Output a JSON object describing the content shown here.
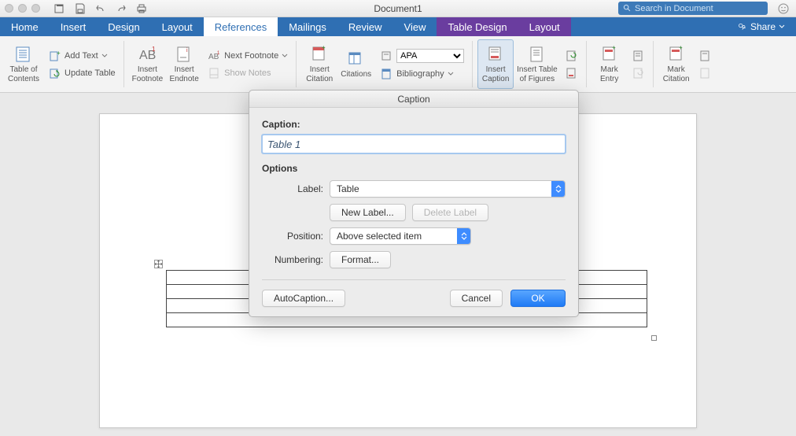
{
  "titlebar": {
    "document_title": "Document1",
    "search_placeholder": "Search in Document"
  },
  "tabs": {
    "items": [
      "Home",
      "Insert",
      "Design",
      "Layout",
      "References",
      "Mailings",
      "Review",
      "View",
      "Table Design",
      "Layout"
    ],
    "selected_index": 4,
    "context_start_index": 8,
    "share_label": "Share"
  },
  "ribbon": {
    "toc": {
      "label_line1": "Table of",
      "label_line2": "Contents",
      "add_text": "Add Text",
      "update_table": "Update Table"
    },
    "footnotes": {
      "insert_footnote": "Insert\nFootnote",
      "insert_endnote": "Insert\nEndnote",
      "next_footnote": "Next Footnote",
      "show_notes": "Show Notes"
    },
    "citations": {
      "insert_citation": "Insert\nCitation",
      "citations": "Citations",
      "style_label": "APA",
      "bibliography": "Bibliography"
    },
    "captions": {
      "insert_caption": "Insert\nCaption",
      "insert_tof": "Insert Table\nof Figures"
    },
    "index": {
      "mark_entry": "Mark\nEntry"
    },
    "authorities": {
      "mark_citation": "Mark\nCitation"
    }
  },
  "dialog": {
    "title": "Caption",
    "heading_caption": "Caption:",
    "caption_value": "Table 1",
    "heading_options": "Options",
    "label_label": "Label:",
    "label_value": "Table",
    "new_label_btn": "New Label...",
    "delete_label_btn": "Delete Label",
    "position_label": "Position:",
    "position_value": "Above selected item",
    "numbering_label": "Numbering:",
    "format_btn": "Format...",
    "autocaption_btn": "AutoCaption...",
    "cancel_btn": "Cancel",
    "ok_btn": "OK"
  }
}
